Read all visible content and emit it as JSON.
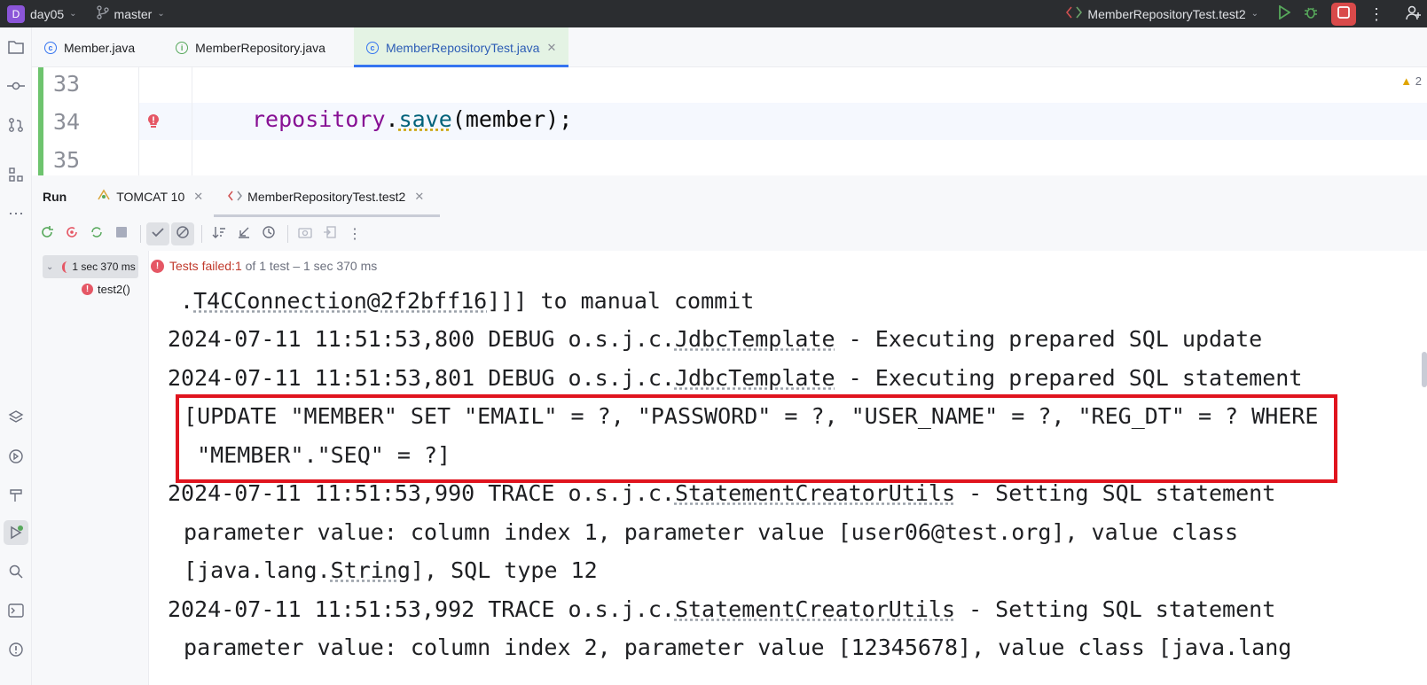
{
  "titlebar": {
    "project_badge": "D",
    "project": "day05",
    "branch": "master",
    "run_config": "MemberRepositoryTest.test2"
  },
  "editor_tabs": [
    {
      "label": "Member.java",
      "icon": "class-icon"
    },
    {
      "label": "MemberRepository.java",
      "icon": "interface-icon"
    },
    {
      "label": "MemberRepositoryTest.java",
      "icon": "test-class-icon",
      "active": true
    }
  ],
  "editor": {
    "lines": [
      {
        "num": "33",
        "code": ""
      },
      {
        "num": "34",
        "code_object": "repository",
        "code_dot": ".",
        "code_method": "save",
        "code_rest": "(member);"
      },
      {
        "num": "35",
        "code": ""
      }
    ],
    "warning_count": "2"
  },
  "run_panel": {
    "title": "Run",
    "tabs": [
      {
        "label": "TOMCAT 10"
      },
      {
        "label": "MemberRepositoryTest.test2",
        "active": true
      }
    ]
  },
  "test_tree": {
    "root_label": "1 sec 370 ms",
    "child_label": "test2()"
  },
  "status": {
    "prefix": "Tests failed: ",
    "failed_count": "1",
    "suffix": " of 1 test – 1 sec 370 ms"
  },
  "console": {
    "l1a": " .",
    "l1b": "T4CConnection@2f2bff16",
    "l1c": "]]] to manual commit",
    "l2a": "2024-07-11 11:51:53,800 DEBUG o.s.j.c.",
    "l2b": "JdbcTemplate",
    "l2c": " - Executing prepared SQL update",
    "l3a": "2024-07-11 11:51:53,801 DEBUG o.s.j.c.",
    "l3b": "JdbcTemplate",
    "l3c": " - Executing prepared SQL statement",
    "l4": " [UPDATE \"MEMBER\" SET \"EMAIL\" = ?, \"PASSWORD\" = ?, \"USER_NAME\" = ?, \"REG_DT\" = ? WHERE",
    "l5": "  \"MEMBER\".\"SEQ\" = ?]",
    "l6a": "2024-07-11 11:51:53,990 TRACE o.s.j.c.",
    "l6b": "StatementCreatorUtils",
    "l6c": " - Setting SQL statement",
    "l7": " parameter value: column index 1, parameter value [user06@test.org], value class",
    "l8a": " [java.lang.",
    "l8b": "String",
    "l8c": "], SQL type 12",
    "l9a": "2024-07-11 11:51:53,992 TRACE o.s.j.c.",
    "l9b": "StatementCreatorUtils",
    "l9c": " - Setting SQL statement",
    "l10": " parameter value: column index 2, parameter value [12345678], value class [java.lang"
  },
  "colors": {
    "highlight_box": "#e0141e",
    "error": "#e55765",
    "active_tab_bg": "#e4f3e4"
  }
}
